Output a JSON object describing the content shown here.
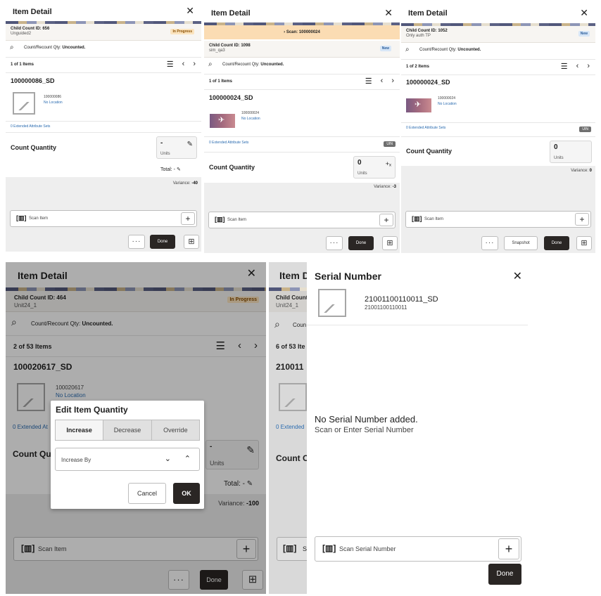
{
  "panel1": {
    "title": "Item Detail",
    "child_count": "Child Count ID: 656",
    "child_sub": "Unguided2",
    "badge": "In Progress",
    "search_prefix": "Count/Recount Qty:",
    "search_value": "Uncounted.",
    "items_count": "1 of 1 Items",
    "item_name": "100000086_SD",
    "item_id": "100000086",
    "location": "No Location",
    "ext_attr": "0 Extended Attribute Sets",
    "count_qty_label": "Count Quantity",
    "qty_value": "-",
    "qty_units": "Units",
    "total": "Total: -",
    "variance_label": "Variance:",
    "variance_value": "-40",
    "scan_placeholder": "Scan Item",
    "more": "···",
    "done": "Done"
  },
  "panel2": {
    "title": "Item Detail",
    "scan_banner": "Scan: 100000024",
    "child_count": "Child Count ID: 1098",
    "child_sub": "sim_qa3",
    "badge": "New",
    "search_prefix": "Count/Recount Qty:",
    "search_value": "Uncounted.",
    "items_count": "1 of 1 Items",
    "item_name": "100000024_SD",
    "item_id": "100000024",
    "location": "No Location",
    "ext_attr": "0 Extended Attribute Sets",
    "uin_tag": "UIN",
    "count_qty_label": "Count Quantity",
    "qty_value": "0",
    "qty_units": "Units",
    "variance_label": "Variance:",
    "variance_value": "-3",
    "scan_placeholder": "Scan Item",
    "more": "···",
    "done": "Done"
  },
  "panel3": {
    "title": "Item Detail",
    "child_count": "Child Count ID: 1052",
    "child_sub": "Only auth TP",
    "badge": "New",
    "search_prefix": "Count/Recount Qty:",
    "search_value": "Uncounted.",
    "items_count": "1 of 2 Items",
    "item_name": "100000024_SD",
    "item_id": "100000024",
    "location": "No Location",
    "ext_attr": "0 Extended Attribute Sets",
    "uin_tag": "UIN",
    "count_qty_label": "Count Quantity",
    "qty_value": "0",
    "qty_units": "Units",
    "variance_label": "Variance:",
    "variance_value": "0",
    "scan_placeholder": "Scan Item",
    "more": "···",
    "snapshot": "Snapshot",
    "done": "Done"
  },
  "panel4": {
    "title": "Item Detail",
    "child_count": "Child Count ID: 464",
    "child_sub": "Unit24_1",
    "badge": "In Progress",
    "search_prefix": "Count/Recount Qty:",
    "search_value": "Uncounted.",
    "items_count": "2 of 53 Items",
    "item_name": "100020617_SD",
    "item_id": "100020617",
    "location": "No Location",
    "ext_attr": "0 Extended At",
    "count_qty_label": "Count Qu",
    "qty_value": "-",
    "qty_units": "Units",
    "total": "Total: -",
    "variance_label": "Variance:",
    "variance_value": "-100",
    "scan_placeholder": "Scan Item",
    "more": "···",
    "done": "Done",
    "dialog": {
      "title": "Edit Item Quantity",
      "tabs": [
        "Increase",
        "Decrease",
        "Override"
      ],
      "increase_by": "Increase By",
      "cancel": "Cancel",
      "ok": "OK"
    }
  },
  "panel5": {
    "title": "Item D",
    "child_count": "Child Count",
    "child_sub": "Unit24_1",
    "search_prefix": "Coun",
    "items_count": "6 of 53 Ite",
    "item_name": "210011",
    "ext_attr": "0 Extended",
    "count_qty_label": "Count C",
    "scan_placeholder": "Sc",
    "serial": {
      "title": "Serial Number",
      "item_name": "21001100110011_SD",
      "item_id": "21001100110011",
      "empty_title": "No Serial Number added.",
      "empty_sub": "Scan or Enter Serial Number",
      "scan_placeholder": "Scan Serial Number",
      "done": "Done"
    }
  }
}
